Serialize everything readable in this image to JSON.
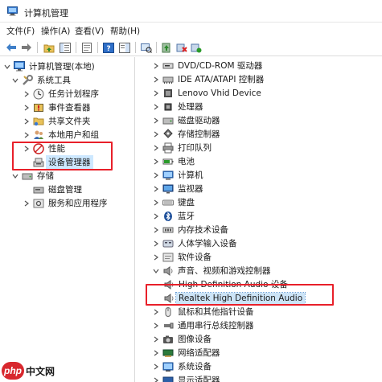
{
  "window": {
    "title": "计算机管理"
  },
  "menu": [
    "文件(F)",
    "操作(A)",
    "查看(V)",
    "帮助(H)"
  ],
  "left_tree": [
    {
      "label": "计算机管理(本地)",
      "icon": "computer-management-icon",
      "expand": "expanded"
    },
    {
      "label": "系统工具",
      "icon": "tools-icon",
      "expand": "expanded"
    },
    {
      "label": "任务计划程序",
      "icon": "clock-icon",
      "expand": "collapsed"
    },
    {
      "label": "事件查看器",
      "icon": "event-viewer-icon",
      "expand": "collapsed"
    },
    {
      "label": "共享文件夹",
      "icon": "shared-folder-icon",
      "expand": "collapsed"
    },
    {
      "label": "本地用户和组",
      "icon": "users-icon",
      "expand": "collapsed"
    },
    {
      "label": "性能",
      "icon": "performance-icon",
      "expand": "collapsed"
    },
    {
      "label": "设备管理器",
      "icon": "device-manager-icon",
      "expand": "none",
      "selected": true
    },
    {
      "label": "存储",
      "icon": "storage-icon",
      "expand": "expanded"
    },
    {
      "label": "磁盘管理",
      "icon": "disk-management-icon",
      "expand": "none"
    },
    {
      "label": "服务和应用程序",
      "icon": "services-icon",
      "expand": "collapsed"
    }
  ],
  "device_tree": [
    {
      "label": "DVD/CD-ROM 驱动器",
      "icon": "dvd-drive-icon",
      "expand": "collapsed"
    },
    {
      "label": "IDE ATA/ATAPI 控制器",
      "icon": "ide-controller-icon",
      "expand": "collapsed"
    },
    {
      "label": "Lenovo Vhid Device",
      "icon": "hid-device-icon",
      "expand": "collapsed"
    },
    {
      "label": "处理器",
      "icon": "processor-icon",
      "expand": "collapsed"
    },
    {
      "label": "磁盘驱动器",
      "icon": "disk-drive-icon",
      "expand": "collapsed"
    },
    {
      "label": "存储控制器",
      "icon": "storage-controller-icon",
      "expand": "collapsed"
    },
    {
      "label": "打印队列",
      "icon": "printer-icon",
      "expand": "collapsed"
    },
    {
      "label": "电池",
      "icon": "battery-icon",
      "expand": "collapsed"
    },
    {
      "label": "计算机",
      "icon": "computer-icon",
      "expand": "collapsed"
    },
    {
      "label": "监视器",
      "icon": "monitor-icon",
      "expand": "collapsed"
    },
    {
      "label": "键盘",
      "icon": "keyboard-icon",
      "expand": "collapsed"
    },
    {
      "label": "蓝牙",
      "icon": "bluetooth-icon",
      "expand": "collapsed"
    },
    {
      "label": "内存技术设备",
      "icon": "memory-device-icon",
      "expand": "collapsed"
    },
    {
      "label": "人体学输入设备",
      "icon": "hid-input-icon",
      "expand": "collapsed"
    },
    {
      "label": "软件设备",
      "icon": "software-device-icon",
      "expand": "collapsed"
    },
    {
      "label": "声音、视频和游戏控制器",
      "icon": "speaker-icon",
      "expand": "expanded"
    },
    {
      "label": "High Definition Audio 设备",
      "icon": "speaker-icon",
      "expand": "none"
    },
    {
      "label": "Realtek High Definition Audio",
      "icon": "speaker-icon",
      "expand": "none",
      "highlight": true
    },
    {
      "label": "鼠标和其他指针设备",
      "icon": "mouse-icon",
      "expand": "collapsed"
    },
    {
      "label": "通用串行总线控制器",
      "icon": "usb-icon",
      "expand": "collapsed"
    },
    {
      "label": "图像设备",
      "icon": "camera-icon",
      "expand": "collapsed"
    },
    {
      "label": "网络适配器",
      "icon": "network-adapter-icon",
      "expand": "collapsed"
    },
    {
      "label": "系统设备",
      "icon": "system-device-icon",
      "expand": "collapsed"
    },
    {
      "label": "显示适配器",
      "icon": "display-adapter-icon",
      "expand": "collapsed"
    }
  ],
  "watermark": {
    "logo": "php",
    "text": "中文网"
  },
  "colors": {
    "annotation_red": "#e8202a",
    "selection": "#cde8ff"
  }
}
